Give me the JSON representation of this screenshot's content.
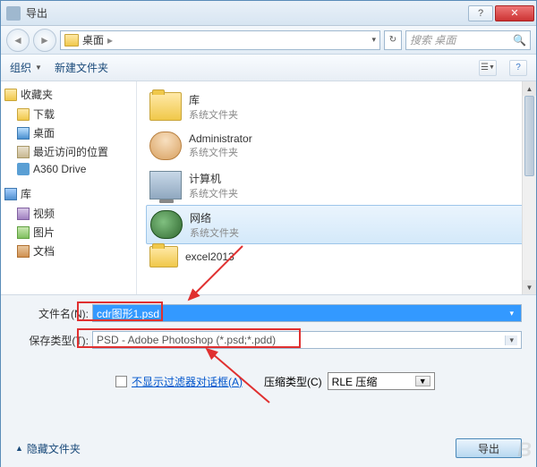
{
  "title": "导出",
  "nav": {
    "location": "桌面",
    "search_placeholder": "搜索 桌面"
  },
  "toolbar": {
    "organize": "组织",
    "new_folder": "新建文件夹"
  },
  "sidebar": {
    "favorites": {
      "label": "收藏夹"
    },
    "items1": [
      {
        "label": "下载"
      },
      {
        "label": "桌面"
      },
      {
        "label": "最近访问的位置"
      },
      {
        "label": "A360 Drive"
      }
    ],
    "libraries": {
      "label": "库"
    },
    "items2": [
      {
        "label": "视频"
      },
      {
        "label": "图片"
      },
      {
        "label": "文档"
      }
    ]
  },
  "files": [
    {
      "name": "库",
      "sub": "系统文件夹"
    },
    {
      "name": "Administrator",
      "sub": "系统文件夹"
    },
    {
      "name": "计算机",
      "sub": "系统文件夹"
    },
    {
      "name": "网络",
      "sub": "系统文件夹"
    },
    {
      "name": "excel2013",
      "sub": ""
    }
  ],
  "form": {
    "filename_label": "文件名(N):",
    "filename_value": "cdr图形1.psd",
    "filetype_label": "保存类型(T):",
    "filetype_value": "PSD - Adobe Photoshop (*.psd;*.pdd)",
    "filter_label": "不显示过滤器对话框(A)",
    "compress_label": "压缩类型(C)",
    "compress_value": "RLE 压缩",
    "expand_label": "隐藏文件夹",
    "export_btn": "导出"
  }
}
